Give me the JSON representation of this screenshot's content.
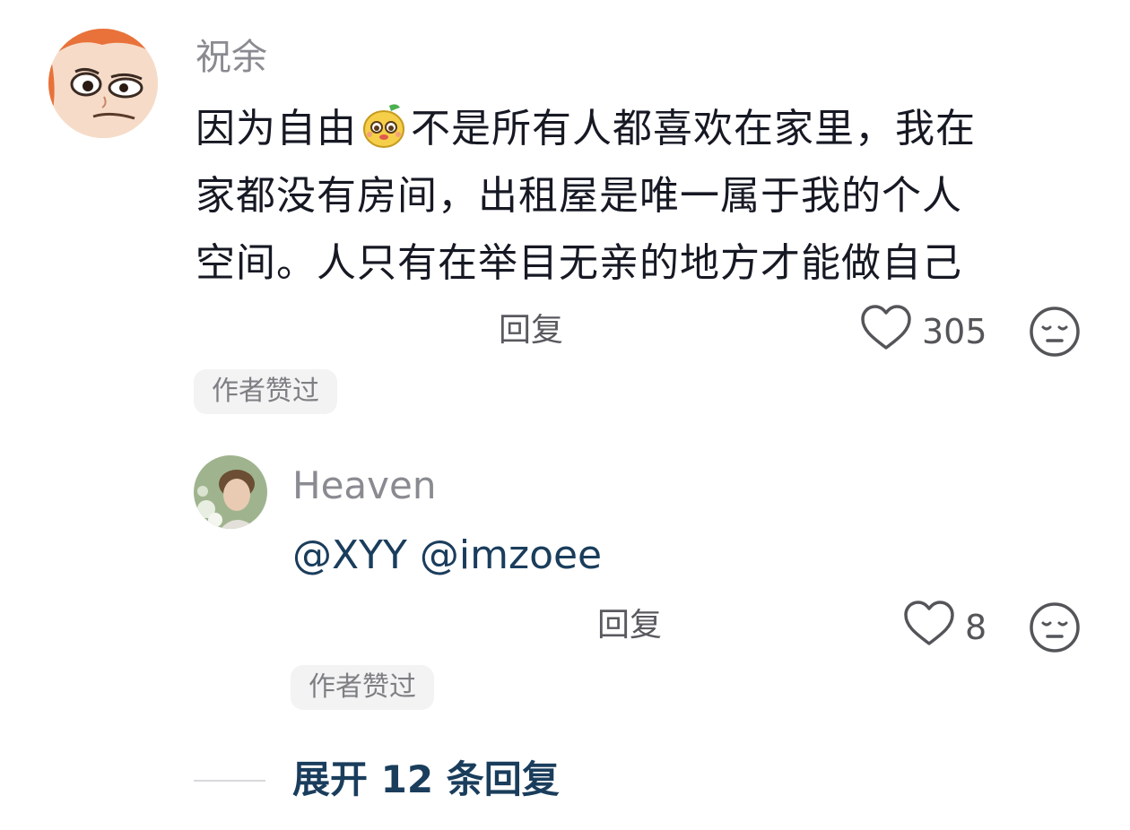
{
  "comment": {
    "username": "祝余",
    "text_part1": "因为自由",
    "inline_emoji": "pear-face-emoji",
    "text_part2": "不是所有人都喜欢在家里，我在",
    "text_line2": "家都没有房间，出租屋是唯一属于我的个人",
    "text_line3": "空间。人只有在举目无亲的地方才能做自己",
    "reply_label": "回复",
    "like_count": "305",
    "author_liked_badge": "作者赞过"
  },
  "reply": {
    "username": "Heaven",
    "text": "@XYY @imzoee",
    "reply_label": "回复",
    "like_count": "8",
    "author_liked_badge": "作者赞过"
  },
  "expand": {
    "label": "展开 12 条回复"
  },
  "icons": {
    "like": "heart-outline-icon",
    "dislike": "meh-face-icon"
  },
  "colors": {
    "mention": "#1a3d5c",
    "username": "#8a8b91",
    "badge_bg": "#f3f3f4"
  }
}
